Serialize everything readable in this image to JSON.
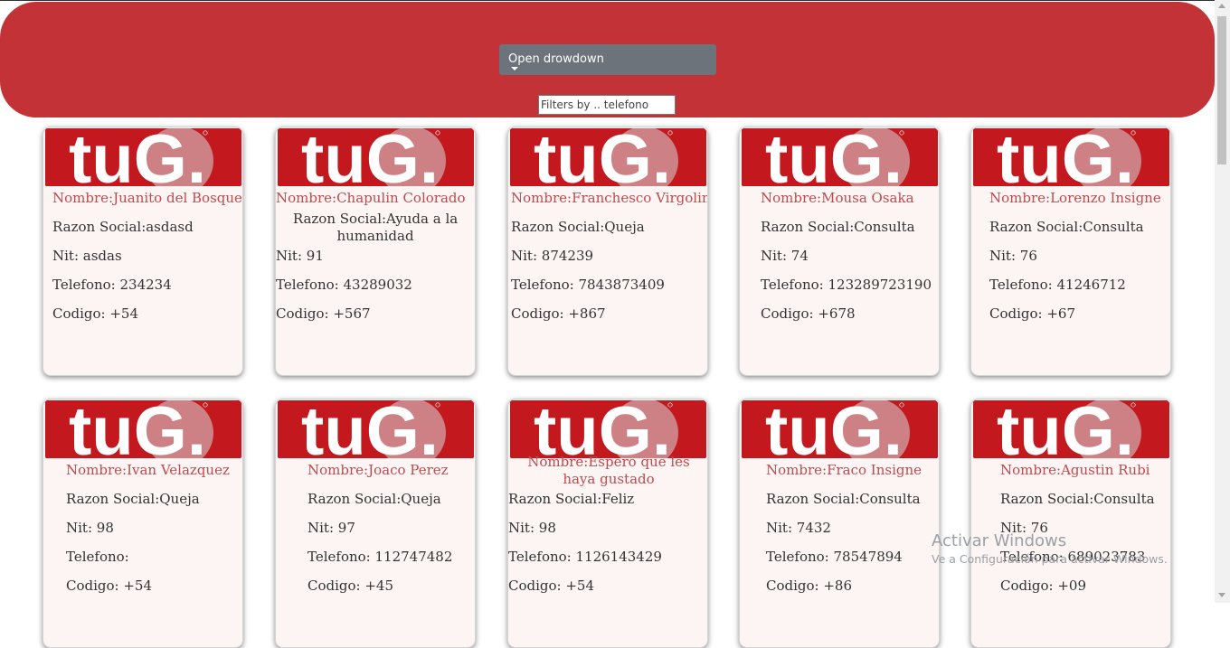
{
  "header": {
    "dropdown_label": "Open drowdown",
    "filter_placeholder": "Filters by .. telefono",
    "accent_color": "#c23236"
  },
  "logo": {
    "text": "tuG.",
    "color": "#c2181e"
  },
  "cards": [
    {
      "nombre": "Nombre:Juanito del Bosque",
      "razon_social": "Razon Social:asdasd",
      "nit": "Nit: asdas",
      "telefono": "Telefono: 234234",
      "codigo": "Codigo: +54"
    },
    {
      "nombre": "Nombre:Chapulin Colorado",
      "razon_social": "Razon Social:Ayuda a la humanidad",
      "nit": "Nit: 91",
      "telefono": "Telefono: 43289032",
      "codigo": "Codigo: +567"
    },
    {
      "nombre": "Nombre:Franchesco Virgolini",
      "razon_social": "Razon Social:Queja",
      "nit": "Nit: 874239",
      "telefono": "Telefono: 7843873409",
      "codigo": "Codigo: +867"
    },
    {
      "nombre": "Nombre:Mousa Osaka",
      "razon_social": "Razon Social:Consulta",
      "nit": "Nit: 74",
      "telefono": "Telefono: 123289723190",
      "codigo": "Codigo: +678"
    },
    {
      "nombre": "Nombre:Lorenzo Insigne",
      "razon_social": "Razon Social:Consulta",
      "nit": "Nit: 76",
      "telefono": "Telefono: 41246712",
      "codigo": "Codigo: +67"
    },
    {
      "nombre": "Nombre:Ivan Velazquez",
      "razon_social": "Razon Social:Queja",
      "nit": "Nit: 98",
      "telefono": "Telefono:",
      "codigo": "Codigo: +54"
    },
    {
      "nombre": "Nombre:Joaco Perez",
      "razon_social": "Razon Social:Queja",
      "nit": "Nit: 97",
      "telefono": "Telefono: 112747482",
      "codigo": "Codigo: +45"
    },
    {
      "nombre": "Nombre:Espero que les haya gustado",
      "razon_social": "Razon Social:Feliz",
      "nit": "Nit: 98",
      "telefono": "Telefono: 1126143429",
      "codigo": "Codigo: +54"
    },
    {
      "nombre": "Nombre:Fraco Insigne",
      "razon_social": "Razon Social:Consulta",
      "nit": "Nit: 7432",
      "telefono": "Telefono: 78547894",
      "codigo": "Codigo: +86"
    },
    {
      "nombre": "Nombre:Agustin Rubi",
      "razon_social": "Razon Social:Consulta",
      "nit": "Nit: 76",
      "telefono": "Telefono: 689023783",
      "codigo": "Codigo: +09"
    }
  ],
  "watermark": {
    "line1": "Activar Windows",
    "line2": "Ve a Configuración para activar Windows."
  }
}
